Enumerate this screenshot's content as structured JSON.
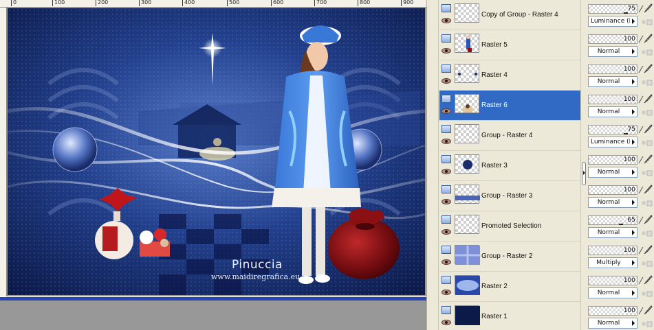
{
  "ruler": {
    "ticks": [
      "0",
      "100",
      "200",
      "300",
      "400",
      "500",
      "600",
      "700",
      "800",
      "900"
    ]
  },
  "artwork": {
    "credit_name": "Pinuccia",
    "credit_url": "www.maidiregrafica.eu"
  },
  "layers": [
    {
      "name": "Copy of Group - Raster 4",
      "opacity": "75",
      "blend_mode": "Luminance (L)",
      "thumb": "empty",
      "selected": false
    },
    {
      "name": "Raster 5",
      "opacity": "100",
      "blend_mode": "Normal",
      "thumb": "figure",
      "selected": false
    },
    {
      "name": "Raster 4",
      "opacity": "100",
      "blend_mode": "Normal",
      "thumb": "dots",
      "selected": false
    },
    {
      "name": "Raster 6",
      "opacity": "100",
      "blend_mode": "Normal",
      "thumb": "nativity",
      "selected": true
    },
    {
      "name": "Group - Raster 4",
      "opacity": "75",
      "blend_mode": "Luminance (L)",
      "thumb": "empty",
      "selected": false
    },
    {
      "name": "Raster 3",
      "opacity": "100",
      "blend_mode": "Normal",
      "thumb": "sphere",
      "selected": false
    },
    {
      "name": "Group - Raster 3",
      "opacity": "100",
      "blend_mode": "Normal",
      "thumb": "stripe",
      "selected": false
    },
    {
      "name": "Promoted Selection",
      "opacity": "65",
      "blend_mode": "Normal",
      "thumb": "empty",
      "selected": false
    },
    {
      "name": "Group - Raster 2",
      "opacity": "100",
      "blend_mode": "Multiply",
      "thumb": "pattern",
      "selected": false
    },
    {
      "name": "Raster 2",
      "opacity": "100",
      "blend_mode": "Normal",
      "thumb": "blue-texture",
      "selected": false
    },
    {
      "name": "Raster 1",
      "opacity": "100",
      "blend_mode": "Normal",
      "thumb": "dark-navy",
      "selected": false
    }
  ],
  "colors": {
    "selection": "#316ac5",
    "palette_bg": "#ece9d8",
    "artwork_navy": "#0c1a4a",
    "canvas_bar": "#2747b8"
  }
}
